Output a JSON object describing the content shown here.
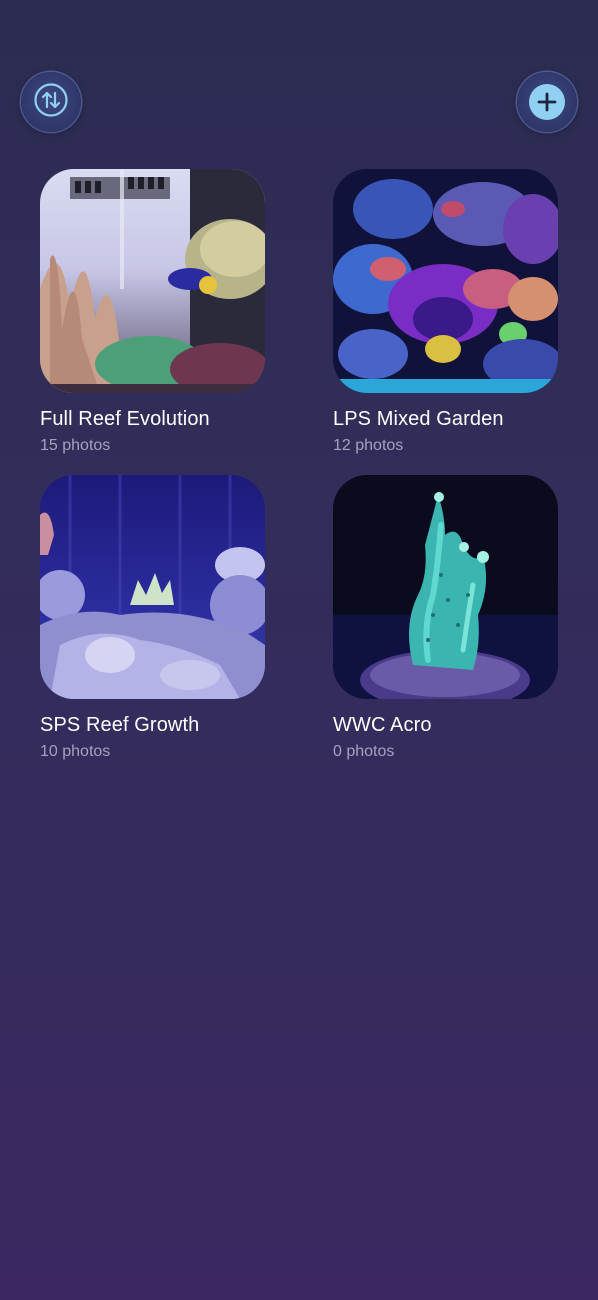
{
  "toolbar": {
    "sort_icon": "sort-arrows-icon",
    "add_icon": "plus-icon",
    "accent_color": "#8fd0f3"
  },
  "albums": [
    {
      "title": "Full Reef Evolution",
      "count": "15 photos"
    },
    {
      "title": "LPS Mixed Garden",
      "count": "12 photos"
    },
    {
      "title": "SPS Reef Growth",
      "count": "10 photos"
    },
    {
      "title": "WWC Acro",
      "count": "0 photos"
    }
  ]
}
